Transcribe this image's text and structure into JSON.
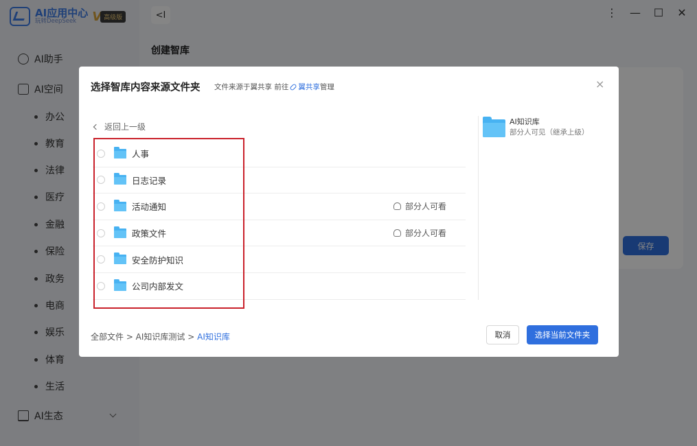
{
  "app": {
    "logo_title": "AI应用中心",
    "logo_subtitle": "玩转DeepSeek",
    "vip_mark": "V",
    "vip_badge": "高级版"
  },
  "sidebar": {
    "main_items": [
      {
        "label": "AI助手"
      },
      {
        "label": "AI空间"
      },
      {
        "label": "AI生态"
      }
    ],
    "space_items": [
      "办公",
      "教育",
      "法律",
      "医疗",
      "金融",
      "保险",
      "政务",
      "电商",
      "娱乐",
      "体育",
      "生活"
    ]
  },
  "topbar": {
    "back_label": "<I",
    "window_controls": {
      "more": "⋮",
      "minimize": "—",
      "maximize": "☐",
      "close": "✕"
    }
  },
  "page": {
    "title": "创建智库",
    "save_label": "保存"
  },
  "modal": {
    "title": "选择智库内容来源文件夹",
    "note_prefix": "文件来源于翼共享 前往",
    "note_link": "翼共享",
    "note_suffix": "管理",
    "close_glyph": "×",
    "back_label": "返回上一级",
    "folders": [
      {
        "name": "人事",
        "access": ""
      },
      {
        "name": "日志记录",
        "access": ""
      },
      {
        "name": "活动通知",
        "access": "部分人可看"
      },
      {
        "name": "政策文件",
        "access": "部分人可看"
      },
      {
        "name": "安全防护知识",
        "access": ""
      },
      {
        "name": "公司内部发文",
        "access": ""
      }
    ],
    "current_folder": {
      "name": "AI知识库",
      "visibility": "部分人可见（继承上级）"
    },
    "breadcrumb": {
      "path": "全部文件 > AI知识库测试 > ",
      "current": "AI知识库"
    },
    "cancel_label": "取消",
    "select_label": "选择当前文件夹"
  },
  "colors": {
    "accent": "#2f6fde",
    "folder": "#47b2f2",
    "highlight": "#c9202a"
  }
}
